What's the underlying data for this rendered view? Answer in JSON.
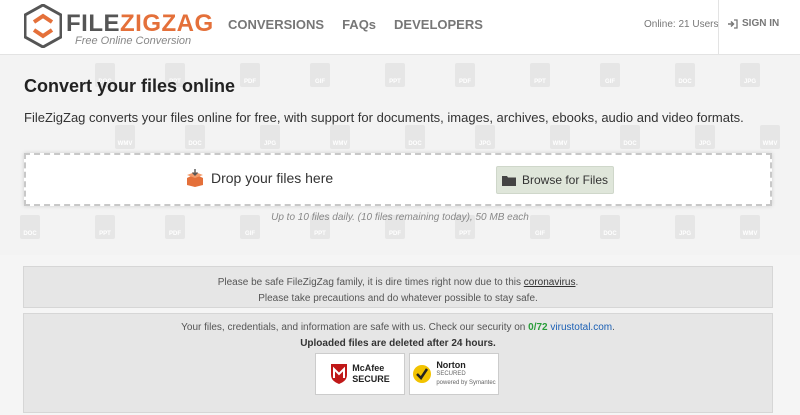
{
  "header": {
    "logo_main": "FILE",
    "logo_accent": "ZIGZAG",
    "logo_tagline": "Free Online Conversion",
    "nav": [
      {
        "label": "CONVERSIONS"
      },
      {
        "label": "FAQs"
      },
      {
        "label": "DEVELOPERS"
      }
    ],
    "online_text": "Online: 21 Users",
    "signin_label": "SIGN IN"
  },
  "hero": {
    "title": "Convert your files online",
    "intro": "FileZigZag converts your files online for free, with support for documents, images, archives, ebooks, audio and video formats.",
    "drop_label": "Drop your files here",
    "browse_label": "Browse for Files",
    "limit_text": "Up to 10 files daily. (10 files remaining today), 50 MB each",
    "background_icons": [
      "DOC",
      "PPT",
      "PDF",
      "GIF",
      "PPT",
      "PDF",
      "PPT",
      "GIF",
      "DOC",
      "JPG",
      "WMV",
      "DOC",
      "JPG",
      "WMV",
      "DOC",
      "JPG",
      "WMV",
      "DOC",
      "JPG",
      "WMV"
    ]
  },
  "notice_safety": {
    "line1_prefix": "Please be safe FileZigZag family, it is dire times right now due to this ",
    "line1_link": "coronavirus",
    "line1_suffix": ".",
    "line2": "Please take precautions and do whatever possible to stay safe."
  },
  "notice_security": {
    "line1_prefix": "Your files, credentials, and information are safe with us. Check our security on ",
    "vt_count": "0/72",
    "vt_link": "virustotal.com",
    "line1_suffix": ".",
    "line2": "Uploaded files are deleted after 24 hours.",
    "badge_mcafee_title": "McAfee",
    "badge_mcafee_sub": "SECURE",
    "badge_norton_title": "Norton",
    "badge_norton_sub": "SECURED",
    "badge_norton_small": "powered by Symantec"
  },
  "colors": {
    "brand_orange": "#e4703a",
    "success_green": "#2a9d3a",
    "link_blue": "#1a5fb4",
    "mcafee_red": "#c01818",
    "norton_yellow": "#f2c300"
  }
}
